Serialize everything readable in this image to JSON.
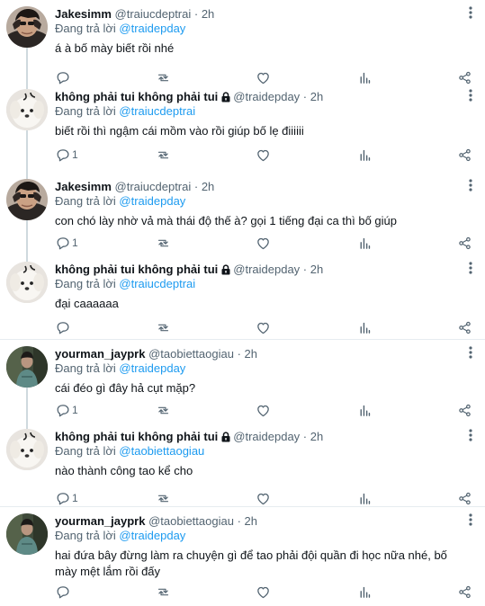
{
  "thread": {
    "tweets": [
      {
        "display_name": "Jakesimm",
        "handle": "@traiucdeptrai",
        "time": "2h",
        "locked": false,
        "reply_label": "Đang trả lời",
        "reply_to": "@traidepday",
        "text": "á à bố mày biết rồi nhé",
        "reply_count": "",
        "avatar": "jakesimm-avatar"
      },
      {
        "display_name": "không phải tui không phải tui",
        "handle": "@traidepday",
        "time": "2h",
        "locked": true,
        "reply_label": "Đang trả lời",
        "reply_to": "@traiucdeptrai",
        "text": "biết rồi thì ngậm cái mồm vào rồi giúp bố lẹ điiiiii",
        "reply_count": "1",
        "avatar": "white-dog-avatar"
      },
      {
        "display_name": "Jakesimm",
        "handle": "@traiucdeptrai",
        "time": "2h",
        "locked": false,
        "reply_label": "Đang trả lời",
        "reply_to": "@traidepday",
        "text": "con chó lày nhờ vả mà thái độ thế à?  gọi 1 tiếng đại ca thì bố giúp",
        "reply_count": "1",
        "avatar": "jakesimm-avatar"
      },
      {
        "display_name": "không phải tui không phải tui",
        "handle": "@traidepday",
        "time": "2h",
        "locked": true,
        "reply_label": "Đang trả lời",
        "reply_to": "@traiucdeptrai",
        "text": "đại caaaaaa",
        "reply_count": "",
        "avatar": "white-dog-avatar"
      },
      {
        "display_name": "yourman_jayprk",
        "handle": "@taobiettaogiau",
        "time": "2h",
        "locked": false,
        "reply_label": "Đang trả lời",
        "reply_to": "@traidepday",
        "text": "cái đéo gì đây hả cụt mặp?",
        "reply_count": "1",
        "avatar": "jayprk-avatar"
      },
      {
        "display_name": "không phải tui không phải tui",
        "handle": "@traidepday",
        "time": "2h",
        "locked": true,
        "reply_label": "Đang trả lời",
        "reply_to": "@taobiettaogiau",
        "text": "nào thành công tao kể cho",
        "reply_count": "1",
        "avatar": "white-dog-avatar"
      },
      {
        "display_name": "yourman_jayprk",
        "handle": "@taobiettaogiau",
        "time": "2h",
        "locked": false,
        "reply_label": "Đang trả lời",
        "reply_to": "@traidepday",
        "text": "hai đứa bây đừng làm ra chuyện gì để tao phải đội quần đi học nữa nhé, bố mày mệt lắm rồi đấy",
        "reply_count": "",
        "avatar": "jayprk-avatar"
      }
    ]
  },
  "colors": {
    "accent": "#1d9bf0",
    "secondary_text": "#536471",
    "thread_line": "#cfd9de",
    "divider": "#e6ecf0"
  },
  "icons": {
    "reply": "comment-icon",
    "retweet": "retweet-icon",
    "like": "heart-icon",
    "views": "views-icon",
    "share": "share-icon",
    "more": "more-icon",
    "protected": "lock-icon"
  }
}
